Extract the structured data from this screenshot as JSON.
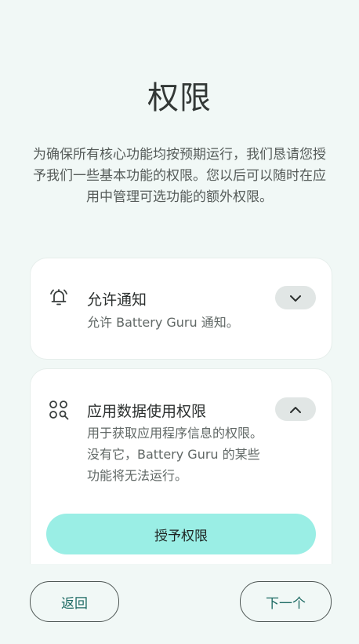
{
  "page": {
    "title": "权限",
    "intro": "为确保所有核心功能均按预期运行，我们恳请您授予我们一些基本功能的权限。您以后可以随时在应用中管理可选功能的额外权限。"
  },
  "permissions": [
    {
      "title": "允许通知",
      "description": "允许 Battery Guru 通知。",
      "icon": "bell-icon",
      "expanded": false
    },
    {
      "title": "应用数据使用权限",
      "description": "用于获取应用程序信息的权限。没有它，Battery Guru 的某些功能将无法运行。",
      "icon": "app-search-icon",
      "expanded": true,
      "action_label": "授予权限"
    }
  ],
  "footer": {
    "back_label": "返回",
    "next_label": "下一个"
  },
  "colors": {
    "background": "#f1f8f6",
    "accent": "#9aeee5",
    "button_text": "#1d6a63"
  }
}
